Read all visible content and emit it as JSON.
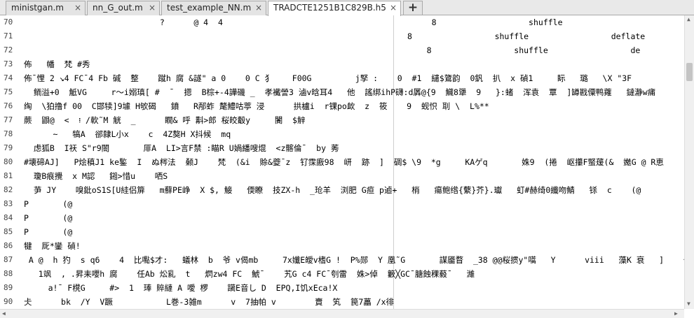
{
  "tabs": [
    {
      "label": "ministgan.m",
      "close": "×"
    },
    {
      "label": "nn_G_out.m",
      "close": "×"
    },
    {
      "label": "test_example_NN.m",
      "close": "×"
    },
    {
      "label": "TRADCTE1251B1C829B.h5",
      "close": "×"
    }
  ],
  "new_tab_label": "+",
  "editor": {
    "lines": [
      {
        "num": "70",
        "text": "                            ?      @ 4  4                                           8                   shuffle"
      },
      {
        "num": "71",
        "text": "                                                                               8                 shuffle                 deflate"
      },
      {
        "num": "72",
        "text": "                                                                                   8                 shuffle                 de"
      },
      {
        "num": "73",
        "text": "佈   幡  梵 #秀"
      },
      {
        "num": "74",
        "text": "佈ˉ悝 2 ↘4 FCˉ4 Fb 碱  整    蹴h 腐 &譢\" a 0    0 C 犭    F00G         j孯 :    0  #1  繾$鷟韵  0釩  扒  x 碵1     眎   璐   \\X \"3F"
      },
      {
        "num": "75",
        "text": "  鲕溢+0  觝VG     r〜i嫋瑱[ #  ˉ  摁  B棕+-4譁磯 _  孝襶謍3 滷v晗耳4   他  謠绑ihP礴:d羼@{9  鱵8犟  9   }:蝫  浑袁  覃  ]罇戡僳鸭蕹   鐽瀞w痡"
      },
      {
        "num": "76",
        "text": "绹  \\狛撸f 00  C邯犊]9壉 H欨碣   鐼   R邴蚱 氂鱧咕葶 浸      拱櫨i  r锞po欰  z  筱    9  蚬怾 刵 \\  L%**"
      },
      {
        "num": "77",
        "text": "蕨  鼰@  <  ፧ /軟˜M 觥  _      瞯& 呼 斠>郎 桜皎觳y     闠  $觪"
      },
      {
        "num": "78",
        "text": "      ~   犒A  郤隸L小x    c  4Z獒H X抖候  mq"
      },
      {
        "num": "79",
        "text": "  虑狐B  I祆 S\"r9閤       厞A  LI>言F禁 :瞄R U媧繙嗖焜  <z髂倫ˉ  by 莠"
      },
      {
        "num": "80",
        "text": "#壊碲AJ]   P烩稹J1 ke鍳  I  ぬ梣法  颡J    梵  (&i  賒&夔ˉz  钌霂廒98  岍  跡  ]  碉$ \\9  *g     KAゲq       姝9  (捲  岖攥F蜸蕿(&  嬔G @ R恵"
      },
      {
        "num": "81",
        "text": "  瓊B痕攪  x M認   鎺>惜u    哂S"
      },
      {
        "num": "82",
        "text": "  芛 JY    嗅鈚oS1S[U絓侣箳   m蘚PE峥  X $, 鯜   偄瞭  技ZX-h  _玱羊  浏肥 G疸 p逌+   梢   瘍鲍绺{蘩}芥}.瓛   虰#赫绮0纖吻鯖   铩  c    (@"
      },
      {
        "num": "83",
        "text": "P       (@"
      },
      {
        "num": "84",
        "text": "P       (@"
      },
      {
        "num": "85",
        "text": "P       (@"
      },
      {
        "num": "86",
        "text": "犍  厑*鑾 碵!"
      },
      {
        "num": "87",
        "text": " A @  h 犳  s q6    4  比嚸$才:   蟻林  b  爷 v偈mb     7x孅E皧v榰G !  P%郧  Y 凰˜G       謀靥瞀  _38 @@桜掼y\"嚆   Y      viii   藻K 衰   ]    崙闆<<觯"
      },
      {
        "num": "88",
        "text": "   1飒  , .昇耒嚶h 腐    任Ab 炂乿  t   熌zw4 FC  鯱ˉ    艽G c4 FCˉ刳雷  姝>倬  籔╳GCˉ膅蝕稞藙ˉ   濰"
      },
      {
        "num": "89",
        "text": "     a!ˉ F櫈G     #>  1  琫 賥縺 A 噯 椤    躏E音し D  EPQ,I饥xEca!X"
      },
      {
        "num": "90",
        "text": "仧      bk  /Y  V蹶           L巻-3雑m      v  7抽帕 v        賣  笂  笢7藟 /x徘"
      }
    ]
  },
  "scrollbars": {
    "vertical": "vertical-scrollbar",
    "horizontal": "horizontal-scrollbar"
  }
}
